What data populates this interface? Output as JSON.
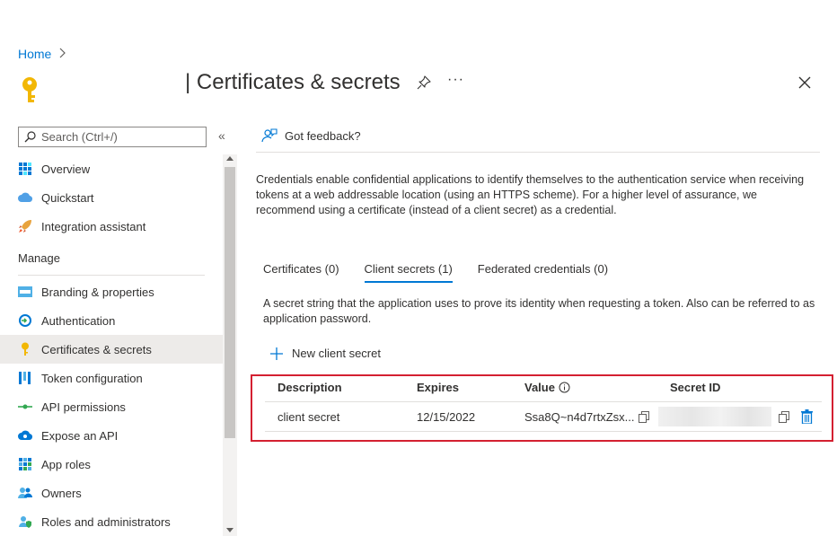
{
  "breadcrumb": {
    "home": "Home",
    "separator": ">"
  },
  "header": {
    "title": "| Certificates & secrets",
    "more": "···"
  },
  "sidebar": {
    "search_placeholder": "Search (Ctrl+/)",
    "collapse": "«",
    "items_top": [
      {
        "label": "Overview",
        "icon": "grid-icon"
      },
      {
        "label": "Quickstart",
        "icon": "cloud-icon"
      },
      {
        "label": "Integration assistant",
        "icon": "rocket-icon"
      }
    ],
    "section_label": "Manage",
    "items_manage": [
      {
        "label": "Branding & properties",
        "icon": "branding-icon"
      },
      {
        "label": "Authentication",
        "icon": "authentication-icon"
      },
      {
        "label": "Certificates & secrets",
        "icon": "key-icon",
        "active": true
      },
      {
        "label": "Token configuration",
        "icon": "token-bars-icon"
      },
      {
        "label": "API permissions",
        "icon": "api-arrow-icon"
      },
      {
        "label": "Expose an API",
        "icon": "cloud-api-icon"
      },
      {
        "label": "App roles",
        "icon": "app-roles-grid-icon"
      },
      {
        "label": "Owners",
        "icon": "users-icon"
      },
      {
        "label": "Roles and administrators",
        "icon": "admin-icon"
      }
    ]
  },
  "main": {
    "feedback": "Got feedback?",
    "description": "Credentials enable confidential applications to identify themselves to the authentication service when receiving tokens at a web addressable location (using an HTTPS scheme). For a higher level of assurance, we recommend using a certificate (instead of a client secret) as a credential.",
    "tabs": [
      {
        "label": "Certificates (0)"
      },
      {
        "label": "Client secrets (1)",
        "active": true
      },
      {
        "label": "Federated credentials (0)"
      }
    ],
    "tab_description": "A secret string that the application uses to prove its identity when requesting a token. Also can be referred to as application password.",
    "new_secret": "New client secret",
    "table": {
      "headers": {
        "description": "Description",
        "expires": "Expires",
        "value": "Value",
        "secret_id": "Secret ID"
      },
      "rows": [
        {
          "description": "client secret",
          "expires": "12/15/2022",
          "value": "Ssa8Q~n4d7rtxZsx..."
        }
      ]
    }
  },
  "colors": {
    "accent": "#0078d4",
    "highlight": "#d42031",
    "key": "#f2b705"
  }
}
